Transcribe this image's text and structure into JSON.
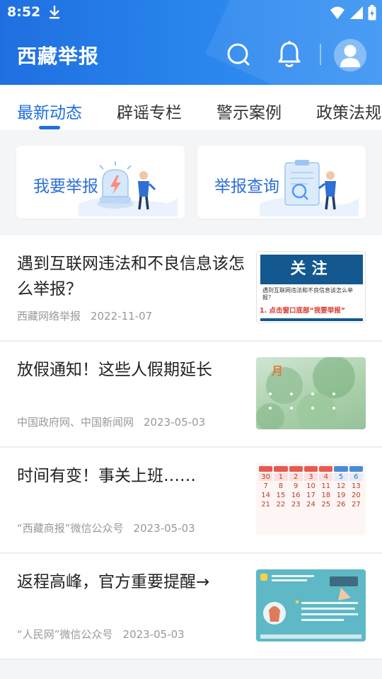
{
  "status_bar": {
    "time": "8:52"
  },
  "header": {
    "title": "西藏举报"
  },
  "tabs": [
    {
      "label": "最新动态",
      "active": true
    },
    {
      "label": "辟谣专栏",
      "active": false
    },
    {
      "label": "警示案例",
      "active": false
    },
    {
      "label": "政策法规",
      "active": false
    }
  ],
  "actions": [
    {
      "label": "我要举报"
    },
    {
      "label": "举报查询"
    }
  ],
  "news": [
    {
      "title": "遇到互联网违法和不良信息该怎么举报？",
      "source": "西藏网络举报",
      "date": "2022-11-07",
      "thumb": {
        "heading": "关注",
        "line1": "遇到互联网违法和不良信息该怎么举报？",
        "line2": "1. 点击窗口底部“我要举报”"
      }
    },
    {
      "title": "放假通知！这些人假期延长",
      "source": "中国政府网、中国新闻网",
      "date": "2023-05-03",
      "thumb": {
        "heading": "月"
      }
    },
    {
      "title": "时间有变！事关上班……",
      "source": "“西藏商报”微信公众号",
      "date": "2023-05-03",
      "thumb": {
        "row1": [
          "30",
          "1",
          "2",
          "3",
          "4",
          "5",
          "6"
        ],
        "row2": [
          "7",
          "8",
          "9",
          "10",
          "11",
          "12",
          "13"
        ],
        "row3": [
          "14",
          "15",
          "16",
          "17",
          "18",
          "19",
          "20"
        ],
        "row4": [
          "21",
          "22",
          "23",
          "24",
          "25",
          "26",
          "27"
        ]
      }
    },
    {
      "title": "返程高峰，官方重要提醒→",
      "source": "“人民网”微信公众号",
      "date": "2023-05-03",
      "thumb": {}
    }
  ],
  "colors": {
    "primary": "#1f6fe0",
    "accent_red": "#d83a2e",
    "text": "#222222",
    "meta": "#999999"
  }
}
